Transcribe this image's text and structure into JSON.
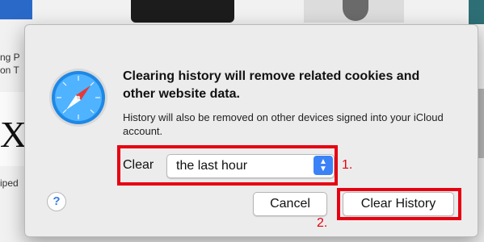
{
  "background": {
    "text_fragments": [
      "ng P",
      "on T",
      "iped"
    ],
    "x_glyph": "X"
  },
  "dialog": {
    "headline": "Clearing history will remove related cookies and other website data.",
    "subtext": "History will also be removed on other devices signed into your iCloud account.",
    "clear_label": "Clear",
    "clear_select_value": "the last hour",
    "help_label": "?",
    "cancel_label": "Cancel",
    "clear_history_label": "Clear History"
  },
  "annotations": {
    "step1": "1.",
    "step2": "2.",
    "color": "#e60012"
  },
  "icons": {
    "app_icon": "safari-compass-icon",
    "stepper": "chevron-up-down-icon"
  },
  "colors": {
    "accent": "#3b82f6",
    "dialog_bg": "#ececec"
  }
}
